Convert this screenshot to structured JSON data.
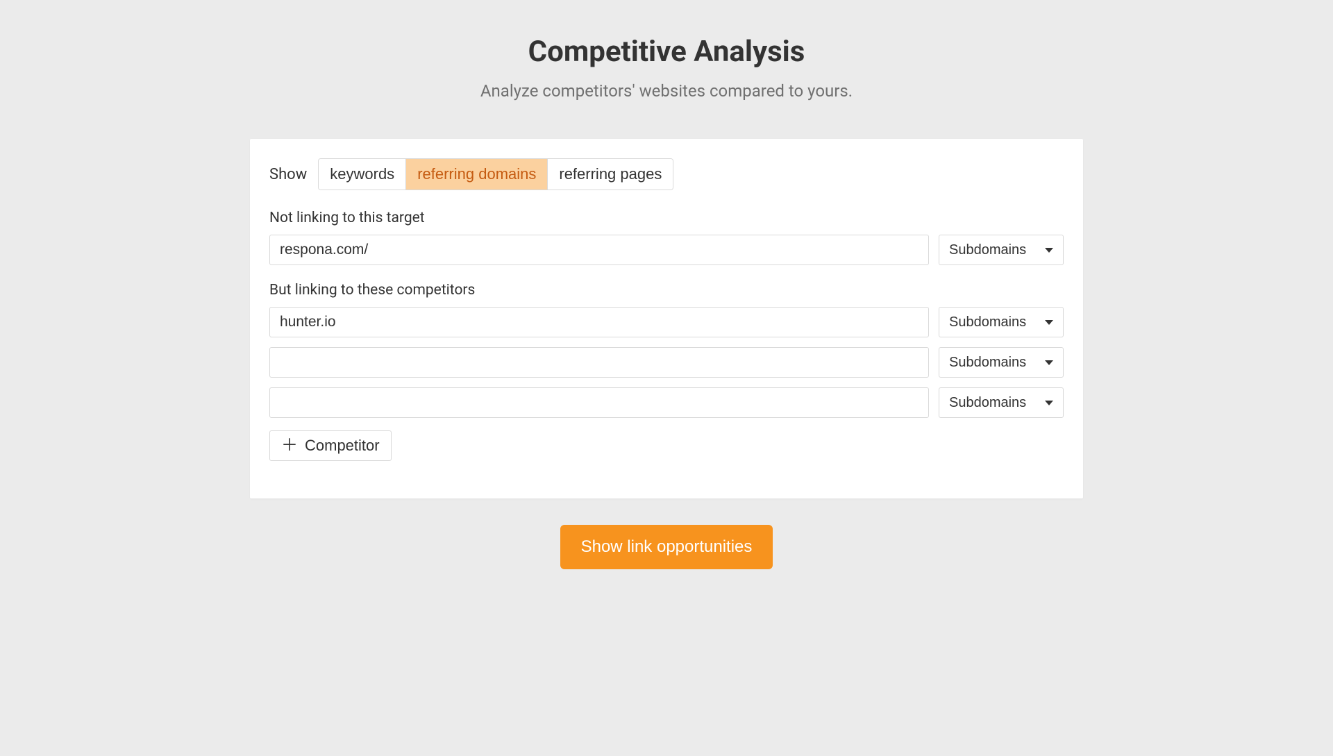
{
  "header": {
    "title": "Competitive Analysis",
    "subtitle": "Analyze competitors' websites compared to yours."
  },
  "show": {
    "label": "Show",
    "tabs": [
      {
        "label": "keywords",
        "active": false
      },
      {
        "label": "referring domains",
        "active": true
      },
      {
        "label": "referring pages",
        "active": false
      }
    ]
  },
  "target_section": {
    "label": "Not linking to this target",
    "input_value": "respona.com/",
    "select_value": "Subdomains"
  },
  "competitors_section": {
    "label": "But linking to these competitors",
    "rows": [
      {
        "input_value": "hunter.io",
        "select_value": "Subdomains"
      },
      {
        "input_value": "",
        "select_value": "Subdomains"
      },
      {
        "input_value": "",
        "select_value": "Subdomains"
      }
    ],
    "add_button_label": "Competitor"
  },
  "cta": {
    "label": "Show link opportunities"
  }
}
